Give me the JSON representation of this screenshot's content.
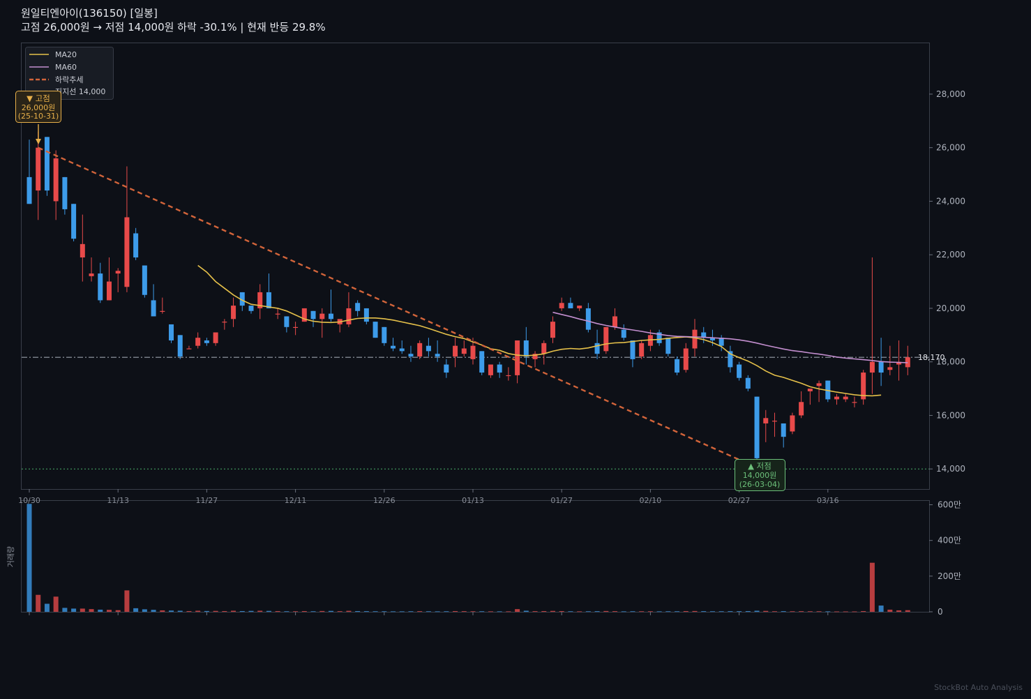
{
  "header": {
    "title": "원일티엔아이(136150)  [일봉]",
    "subtitle": "고점 26,000원 → 저점 14,000원  하락 -30.1%  |  현재 반등 29.8%"
  },
  "watermark": "StockBot Auto Analysis",
  "colors": {
    "background": "#0d1017",
    "up": "#e84a4a",
    "down": "#3d9be9",
    "ma20": "#e6c14a",
    "ma60": "#c48fd0",
    "trend": "#d2643a",
    "support": "#4caf6a",
    "current_line": "#9aa0aa",
    "peak": "#e8b04a",
    "trough": "#6cc07a"
  },
  "chart_data": {
    "type": "candlestick",
    "title": "원일티엔아이(136150)  [일봉]",
    "x_ticks": [
      "10/30",
      "11/13",
      "11/27",
      "12/11",
      "12/26",
      "01/13",
      "01/27",
      "02/10",
      "02/27",
      "03/16"
    ],
    "y_ticks": [
      "14,000",
      "16,000",
      "18,000",
      "20,000",
      "22,000",
      "24,000",
      "26,000",
      "28,000"
    ],
    "ylim": [
      13250,
      29900
    ],
    "volume_ticks": [
      "0",
      "200만",
      "400만",
      "600만"
    ],
    "volume_ylabel": "거래량",
    "volume_ylim": [
      0,
      6100000
    ],
    "legend": {
      "position": "top-left",
      "items": [
        "MA20",
        "MA60",
        "하락추세",
        "지지선 14,000"
      ]
    },
    "current_price_label": "18,170",
    "current_price": 18170,
    "support_level": 14000,
    "peak": {
      "label": "▼ 고점",
      "price": "26,000원",
      "date": "(25-10-31)",
      "price_value": 26000
    },
    "trough": {
      "label": "▲ 저점",
      "price": "14,000원",
      "date": "(26-03-04)",
      "price_value": 14000
    },
    "trend_line": {
      "from_price": 26000,
      "to_price": 14200
    },
    "candles": [
      {
        "o": 24900,
        "h": 26300,
        "l": 23900,
        "c": 23900,
        "v": 6050000
      },
      {
        "o": 24400,
        "h": 26600,
        "l": 23300,
        "c": 26000,
        "v": 950000
      },
      {
        "o": 26400,
        "h": 26400,
        "l": 24200,
        "c": 24400,
        "v": 450000
      },
      {
        "o": 24000,
        "h": 25900,
        "l": 23300,
        "c": 25600,
        "v": 850000
      },
      {
        "o": 24900,
        "h": 24900,
        "l": 23500,
        "c": 23700,
        "v": 220000
      },
      {
        "o": 23900,
        "h": 23900,
        "l": 22500,
        "c": 22600,
        "v": 180000
      },
      {
        "o": 21900,
        "h": 23500,
        "l": 21000,
        "c": 22400,
        "v": 180000
      },
      {
        "o": 21200,
        "h": 21900,
        "l": 21000,
        "c": 21300,
        "v": 150000
      },
      {
        "o": 21300,
        "h": 21700,
        "l": 20200,
        "c": 20300,
        "v": 120000
      },
      {
        "o": 20300,
        "h": 21900,
        "l": 20300,
        "c": 21000,
        "v": 110000
      },
      {
        "o": 21300,
        "h": 21500,
        "l": 20600,
        "c": 21400,
        "v": 90000
      },
      {
        "o": 20800,
        "h": 25300,
        "l": 20600,
        "c": 23400,
        "v": 1200000
      },
      {
        "o": 22800,
        "h": 23000,
        "l": 21800,
        "c": 21900,
        "v": 200000
      },
      {
        "o": 21600,
        "h": 21600,
        "l": 20400,
        "c": 20500,
        "v": 140000
      },
      {
        "o": 20300,
        "h": 20900,
        "l": 19700,
        "c": 19700,
        "v": 110000
      },
      {
        "o": 19900,
        "h": 20400,
        "l": 19800,
        "c": 19900,
        "v": 80000
      },
      {
        "o": 19400,
        "h": 19400,
        "l": 18700,
        "c": 18800,
        "v": 70000
      },
      {
        "o": 19000,
        "h": 19000,
        "l": 18100,
        "c": 18200,
        "v": 60000
      },
      {
        "o": 18500,
        "h": 18600,
        "l": 18500,
        "c": 18500,
        "v": 40000
      },
      {
        "o": 18600,
        "h": 19100,
        "l": 18500,
        "c": 18900,
        "v": 60000
      },
      {
        "o": 18800,
        "h": 18900,
        "l": 18600,
        "c": 18700,
        "v": 45000
      },
      {
        "o": 18700,
        "h": 19100,
        "l": 18600,
        "c": 19100,
        "v": 50000
      },
      {
        "o": 19500,
        "h": 19600,
        "l": 19200,
        "c": 19500,
        "v": 40000
      },
      {
        "o": 19600,
        "h": 20400,
        "l": 19300,
        "c": 20100,
        "v": 60000
      },
      {
        "o": 20600,
        "h": 20600,
        "l": 19900,
        "c": 20100,
        "v": 40000
      },
      {
        "o": 20100,
        "h": 20100,
        "l": 19800,
        "c": 19900,
        "v": 50000
      },
      {
        "o": 20000,
        "h": 20900,
        "l": 19600,
        "c": 20600,
        "v": 60000
      },
      {
        "o": 20600,
        "h": 21300,
        "l": 20000,
        "c": 20000,
        "v": 50000
      },
      {
        "o": 19800,
        "h": 20000,
        "l": 19600,
        "c": 19800,
        "v": 40000
      },
      {
        "o": 19700,
        "h": 19700,
        "l": 19100,
        "c": 19300,
        "v": 30000
      },
      {
        "o": 19300,
        "h": 19500,
        "l": 19000,
        "c": 19300,
        "v": 30000
      },
      {
        "o": 19500,
        "h": 20000,
        "l": 19500,
        "c": 20000,
        "v": 40000
      },
      {
        "o": 19900,
        "h": 19900,
        "l": 19300,
        "c": 19600,
        "v": 30000
      },
      {
        "o": 19600,
        "h": 20000,
        "l": 18900,
        "c": 19800,
        "v": 45000
      },
      {
        "o": 19800,
        "h": 20700,
        "l": 19500,
        "c": 19600,
        "v": 50000
      },
      {
        "o": 19400,
        "h": 19500,
        "l": 19100,
        "c": 19600,
        "v": 35000
      },
      {
        "o": 19400,
        "h": 20600,
        "l": 19300,
        "c": 20000,
        "v": 55000
      },
      {
        "o": 20200,
        "h": 20300,
        "l": 19700,
        "c": 19900,
        "v": 40000
      },
      {
        "o": 20000,
        "h": 20000,
        "l": 19400,
        "c": 19500,
        "v": 35000
      },
      {
        "o": 19500,
        "h": 19500,
        "l": 18900,
        "c": 18900,
        "v": 30000
      },
      {
        "o": 19300,
        "h": 19300,
        "l": 18600,
        "c": 18700,
        "v": 30000
      },
      {
        "o": 18600,
        "h": 18900,
        "l": 18400,
        "c": 18500,
        "v": 25000
      },
      {
        "o": 18500,
        "h": 18800,
        "l": 18300,
        "c": 18400,
        "v": 25000
      },
      {
        "o": 18300,
        "h": 18600,
        "l": 18000,
        "c": 18200,
        "v": 30000
      },
      {
        "o": 18200,
        "h": 18800,
        "l": 18100,
        "c": 18700,
        "v": 35000
      },
      {
        "o": 18600,
        "h": 18900,
        "l": 18200,
        "c": 18400,
        "v": 30000
      },
      {
        "o": 18300,
        "h": 18800,
        "l": 18000,
        "c": 18200,
        "v": 25000
      },
      {
        "o": 17900,
        "h": 18100,
        "l": 17400,
        "c": 17600,
        "v": 30000
      },
      {
        "o": 18200,
        "h": 18900,
        "l": 17800,
        "c": 18600,
        "v": 40000
      },
      {
        "o": 18300,
        "h": 18800,
        "l": 18200,
        "c": 18500,
        "v": 35000
      },
      {
        "o": 18100,
        "h": 18900,
        "l": 17900,
        "c": 18600,
        "v": 30000
      },
      {
        "o": 18400,
        "h": 18400,
        "l": 17500,
        "c": 17600,
        "v": 30000
      },
      {
        "o": 17500,
        "h": 17900,
        "l": 17400,
        "c": 17900,
        "v": 25000
      },
      {
        "o": 17900,
        "h": 18000,
        "l": 17400,
        "c": 17600,
        "v": 25000
      },
      {
        "o": 17500,
        "h": 17800,
        "l": 17300,
        "c": 17500,
        "v": 25000
      },
      {
        "o": 17500,
        "h": 18500,
        "l": 17200,
        "c": 18800,
        "v": 150000
      },
      {
        "o": 18800,
        "h": 19300,
        "l": 17900,
        "c": 18200,
        "v": 60000
      },
      {
        "o": 18100,
        "h": 18400,
        "l": 17800,
        "c": 18300,
        "v": 35000
      },
      {
        "o": 18300,
        "h": 18800,
        "l": 17900,
        "c": 18700,
        "v": 40000
      },
      {
        "o": 18900,
        "h": 19700,
        "l": 18700,
        "c": 19500,
        "v": 50000
      },
      {
        "o": 20000,
        "h": 20400,
        "l": 19900,
        "c": 20200,
        "v": 40000
      },
      {
        "o": 20200,
        "h": 20400,
        "l": 20000,
        "c": 20000,
        "v": 30000
      },
      {
        "o": 20000,
        "h": 20100,
        "l": 19900,
        "c": 20100,
        "v": 25000
      },
      {
        "o": 20000,
        "h": 20200,
        "l": 19100,
        "c": 19200,
        "v": 30000
      },
      {
        "o": 18700,
        "h": 19200,
        "l": 18100,
        "c": 18300,
        "v": 35000
      },
      {
        "o": 18400,
        "h": 19300,
        "l": 18300,
        "c": 19300,
        "v": 45000
      },
      {
        "o": 19300,
        "h": 20000,
        "l": 19200,
        "c": 19700,
        "v": 35000
      },
      {
        "o": 19200,
        "h": 19400,
        "l": 18800,
        "c": 18900,
        "v": 25000
      },
      {
        "o": 18800,
        "h": 18800,
        "l": 17800,
        "c": 18100,
        "v": 30000
      },
      {
        "o": 18200,
        "h": 18800,
        "l": 18100,
        "c": 18700,
        "v": 30000
      },
      {
        "o": 18600,
        "h": 19200,
        "l": 18400,
        "c": 19000,
        "v": 30000
      },
      {
        "o": 19100,
        "h": 19200,
        "l": 18600,
        "c": 18700,
        "v": 25000
      },
      {
        "o": 18900,
        "h": 18900,
        "l": 18200,
        "c": 18300,
        "v": 30000
      },
      {
        "o": 18100,
        "h": 18200,
        "l": 17500,
        "c": 17600,
        "v": 30000
      },
      {
        "o": 17700,
        "h": 18700,
        "l": 17600,
        "c": 18500,
        "v": 40000
      },
      {
        "o": 18500,
        "h": 19600,
        "l": 18200,
        "c": 19200,
        "v": 45000
      },
      {
        "o": 19100,
        "h": 19300,
        "l": 18700,
        "c": 18900,
        "v": 35000
      },
      {
        "o": 18900,
        "h": 19200,
        "l": 18600,
        "c": 18800,
        "v": 30000
      },
      {
        "o": 18900,
        "h": 19000,
        "l": 18400,
        "c": 18600,
        "v": 30000
      },
      {
        "o": 18400,
        "h": 18600,
        "l": 17600,
        "c": 17800,
        "v": 35000
      },
      {
        "o": 17900,
        "h": 18000,
        "l": 17300,
        "c": 17400,
        "v": 35000
      },
      {
        "o": 17400,
        "h": 17500,
        "l": 16900,
        "c": 17000,
        "v": 40000
      },
      {
        "o": 16700,
        "h": 16700,
        "l": 14200,
        "c": 14400,
        "v": 60000
      },
      {
        "o": 15700,
        "h": 16200,
        "l": 15000,
        "c": 15900,
        "v": 50000
      },
      {
        "o": 15800,
        "h": 16100,
        "l": 15200,
        "c": 15800,
        "v": 30000
      },
      {
        "o": 15700,
        "h": 15700,
        "l": 14800,
        "c": 15200,
        "v": 35000
      },
      {
        "o": 15400,
        "h": 16100,
        "l": 15300,
        "c": 16000,
        "v": 30000
      },
      {
        "o": 16000,
        "h": 16900,
        "l": 15900,
        "c": 16500,
        "v": 35000
      },
      {
        "o": 16900,
        "h": 16900,
        "l": 16400,
        "c": 17000,
        "v": 30000
      },
      {
        "o": 17100,
        "h": 17300,
        "l": 16500,
        "c": 17200,
        "v": 30000
      },
      {
        "o": 17300,
        "h": 17300,
        "l": 16500,
        "c": 16600,
        "v": 25000
      },
      {
        "o": 16600,
        "h": 16800,
        "l": 16400,
        "c": 16700,
        "v": 20000
      },
      {
        "o": 16600,
        "h": 16800,
        "l": 16500,
        "c": 16700,
        "v": 20000
      },
      {
        "o": 16500,
        "h": 16700,
        "l": 16300,
        "c": 16500,
        "v": 20000
      },
      {
        "o": 16600,
        "h": 17700,
        "l": 16400,
        "c": 17600,
        "v": 40000
      },
      {
        "o": 17600,
        "h": 21900,
        "l": 16800,
        "c": 18000,
        "v": 2750000
      },
      {
        "o": 18000,
        "h": 18900,
        "l": 17100,
        "c": 17600,
        "v": 350000
      },
      {
        "o": 17700,
        "h": 18600,
        "l": 17500,
        "c": 17800,
        "v": 120000
      },
      {
        "o": 17900,
        "h": 18800,
        "l": 17300,
        "c": 18000,
        "v": 80000
      },
      {
        "o": 17800,
        "h": 18600,
        "l": 17500,
        "c": 18170,
        "v": 90000
      }
    ],
    "ma20": [
      null,
      null,
      null,
      null,
      null,
      null,
      null,
      null,
      null,
      null,
      null,
      null,
      null,
      null,
      null,
      null,
      null,
      null,
      null,
      21600,
      21350,
      21000,
      20750,
      20500,
      20300,
      20150,
      20100,
      20050,
      20000,
      19900,
      19750,
      19600,
      19520,
      19480,
      19470,
      19490,
      19560,
      19620,
      19640,
      19640,
      19610,
      19560,
      19490,
      19420,
      19350,
      19250,
      19140,
      19030,
      18940,
      18870,
      18740,
      18630,
      18490,
      18430,
      18310,
      18250,
      18230,
      18250,
      18300,
      18400,
      18470,
      18500,
      18480,
      18520,
      18600,
      18670,
      18710,
      18720,
      18760,
      18800,
      18820,
      18840,
      18880,
      18910,
      18930,
      18900,
      18830,
      18720,
      18570,
      18300,
      18160,
      18030,
      17860,
      17660,
      17500,
      17420,
      17310,
      17200,
      17070,
      16990,
      16930,
      16870,
      16820,
      16770,
      16740,
      16730,
      16760
    ],
    "ma60": [
      null,
      null,
      null,
      null,
      null,
      null,
      null,
      null,
      null,
      null,
      null,
      null,
      null,
      null,
      null,
      null,
      null,
      null,
      null,
      null,
      null,
      null,
      null,
      null,
      null,
      null,
      null,
      null,
      null,
      null,
      null,
      null,
      null,
      null,
      null,
      null,
      null,
      null,
      null,
      null,
      null,
      null,
      null,
      null,
      null,
      null,
      null,
      null,
      null,
      null,
      null,
      null,
      null,
      null,
      null,
      null,
      null,
      null,
      null,
      19850,
      19770,
      19690,
      19600,
      19520,
      19430,
      19360,
      19300,
      19240,
      19190,
      19140,
      19080,
      19030,
      18980,
      18950,
      18940,
      18930,
      18920,
      18900,
      18880,
      18860,
      18820,
      18770,
      18700,
      18620,
      18550,
      18480,
      18420,
      18380,
      18330,
      18290,
      18240,
      18180,
      18140,
      18110,
      18080,
      18050,
      18010,
      17990,
      17980,
      17970
    ]
  }
}
